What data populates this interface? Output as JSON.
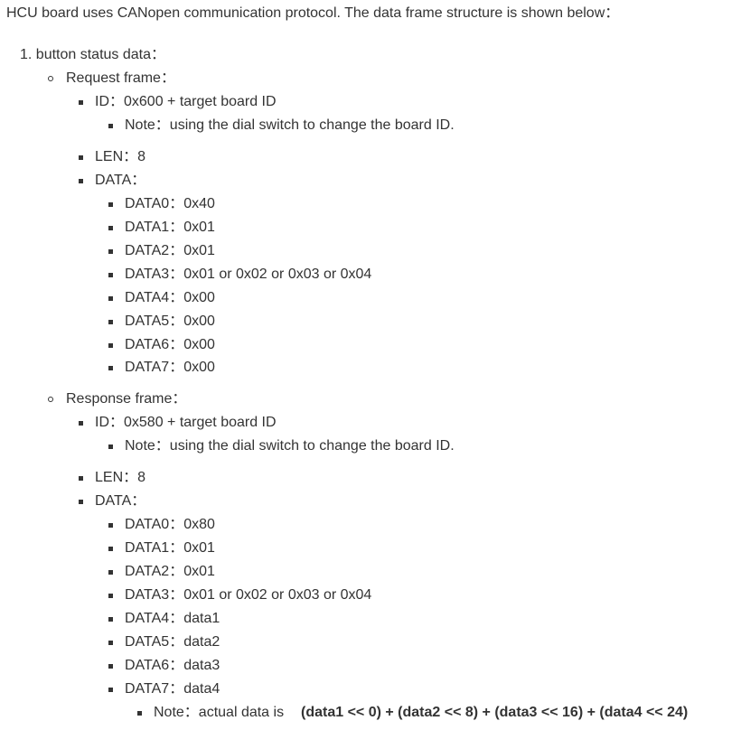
{
  "intro": "HCU board uses CANopen communication protocol. The data frame structure is shown below：",
  "section": {
    "number": "1.",
    "title": "button status data：",
    "request": {
      "label": "Request frame：",
      "id": "ID：0x600 + target board ID",
      "id_note": "Note：using the dial switch to change the board ID.",
      "len": "LEN：8",
      "data_label": "DATA：",
      "data": [
        "DATA0：0x40",
        "DATA1：0x01",
        "DATA2：0x01",
        "DATA3：0x01 or 0x02 or 0x03 or 0x04",
        "DATA4：0x00",
        "DATA5：0x00",
        "DATA6：0x00",
        "DATA7：0x00"
      ]
    },
    "response": {
      "label": "Response frame：",
      "id": "ID：0x580 + target board ID",
      "id_note": "Note：using the dial switch to change the board ID.",
      "len": "LEN：8",
      "data_label": "DATA：",
      "data": [
        "DATA0：0x80",
        "DATA1：0x01",
        "DATA2：0x01",
        "DATA3：0x01 or 0x02 or 0x03 or 0x04",
        "DATA4：data1",
        "DATA5：data2",
        "DATA6：data3",
        "DATA7：data4"
      ],
      "data_note_prefix": "Note：actual data is",
      "data_note_formula": "(data1 << 0) + (data2 << 8) + (data3 << 16) + (data4 << 24)"
    }
  }
}
